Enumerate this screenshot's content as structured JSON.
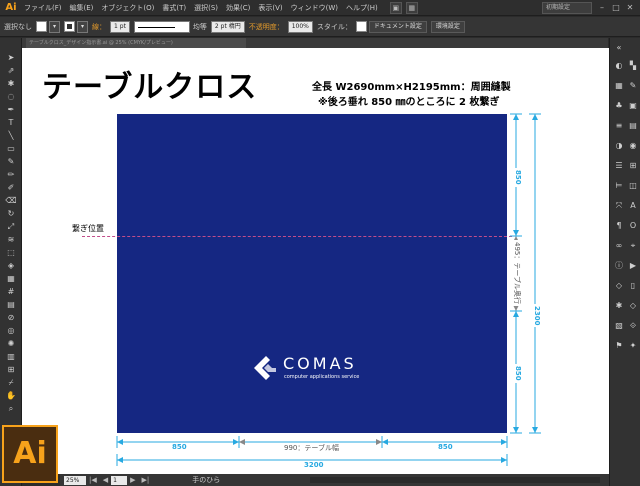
{
  "app": {
    "logo_text": "Ai"
  },
  "menu": {
    "items": [
      "ファイル(F)",
      "編集(E)",
      "オブジェクト(O)",
      "書式(T)",
      "選択(S)",
      "効果(C)",
      "表示(V)",
      "ウィンドウ(W)",
      "ヘルプ(H)"
    ],
    "workspace_label": "初期設定",
    "window_controls": [
      "–",
      "□",
      "✕"
    ]
  },
  "control_bar": {
    "selection_label": "選択なし",
    "stroke_label": "線：",
    "stroke_weight": "1 pt",
    "stroke_profile": "均等",
    "brush": "2 pt 楕円",
    "opacity_label": "不透明度：",
    "opacity_value": "100%",
    "style_label": "スタイル：",
    "doc_setup_button": "ドキュメント設定",
    "env_setup_button": "環境設定"
  },
  "document_tab": {
    "label": "テーブルクロス_デザイン指示書.ai @ 25% (CMYK/プレビュー)"
  },
  "artboard": {
    "title": "テーブルクロス",
    "spec_line1": "全長 W2690mm×H2195mm：周囲縫製",
    "spec_line2": "※後ろ垂れ 850 ㎜のところに 2 枚繋ぎ",
    "seam_label": "繋ぎ位置",
    "cloth_color": "#152782",
    "dim_color": "#27a9e1",
    "logo": {
      "name": "COMAS",
      "tagline": "computer applications service"
    },
    "dimensions": {
      "right_top": "850",
      "right_middle": "495：テーブル奥行",
      "right_bottom": "850",
      "right_total": "2300",
      "bottom_left": "850",
      "bottom_middle": "990：テーブル幅",
      "bottom_right": "850",
      "bottom_total": "3200"
    }
  },
  "status_bar": {
    "zoom": "25%",
    "page": "1",
    "tool_status": "手のひら"
  }
}
